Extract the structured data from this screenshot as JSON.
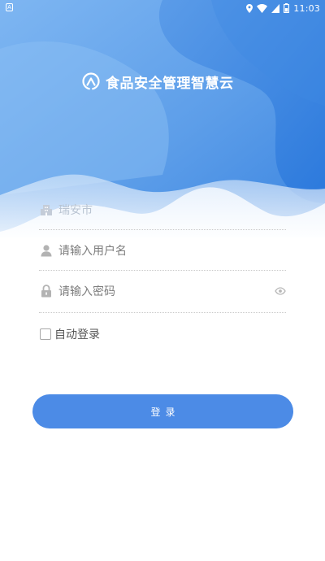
{
  "status_bar": {
    "left_icon": "A",
    "time": "11:03",
    "icons": [
      "location-icon",
      "wifi-icon",
      "signal-icon",
      "battery-icon"
    ]
  },
  "header": {
    "title": "食品安全管理智慧云",
    "logo_icon": "cloud-arrow-logo-icon"
  },
  "form": {
    "city": {
      "value": "瑞安市",
      "icon": "building-icon"
    },
    "username": {
      "placeholder": "请输入用户名",
      "icon": "user-icon"
    },
    "password": {
      "placeholder": "请输入密码",
      "icon": "lock-icon",
      "toggle_icon": "eye-icon"
    },
    "remember": {
      "label": "自动登录",
      "checked": false
    },
    "login_label": "登录"
  },
  "colors": {
    "primary": "#4c8be6",
    "header_light": "#6aa8ef",
    "header_dark": "#2f7ee0",
    "divider": "#c8c8c8",
    "text_gray": "#7d7d7d"
  }
}
